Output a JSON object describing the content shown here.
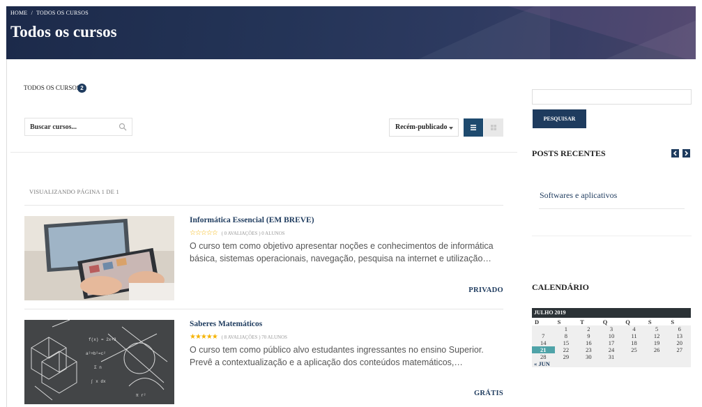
{
  "header": {
    "breadcrumb_home": "HOME",
    "breadcrumb_sep": "/",
    "breadcrumb_current": "TODOS OS CURSOS",
    "title": "Todos os cursos"
  },
  "main": {
    "count_label": "TODOS OS CURSOS",
    "count": "2",
    "search_placeholder": "Buscar cursos...",
    "sort_value": "Recém-publicado",
    "paging": "VISUALIZANDO PÁGINA 1 DE 1",
    "courses": [
      {
        "title": "Informática Essencial (EM BREVE)",
        "rating": 0,
        "reviews": "( 0 AVALIAÇÕES )",
        "students": "0 ALUNOS",
        "description": "O curso tem como objetivo apresentar noções e conhecimentos de informática básica, sistemas operacionais, navegação, pesquisa na internet e utilização…",
        "price": "PRIVADO"
      },
      {
        "title": "Saberes Matemáticos",
        "rating": 5,
        "reviews": "( 8 AVALIAÇÕES )",
        "students": "70 ALUNOS",
        "description": "O curso tem como público alvo estudantes ingressantes no ensino Superior. Prevê a contextualização e a aplicação dos conteúdos matemáticos,…",
        "price": "GRÁTIS"
      }
    ]
  },
  "sidebar": {
    "search_button": "PESQUISAR",
    "recent_heading": "POSTS RECENTES",
    "recent_posts": [
      "Softwares e aplicativos"
    ],
    "calendar_heading": "CALENDÁRIO",
    "calendar": {
      "month": "JULHO 2019",
      "weekdays": [
        "D",
        "S",
        "T",
        "Q",
        "Q",
        "S",
        "S"
      ],
      "weeks": [
        [
          "",
          "1",
          "2",
          "3",
          "4",
          "5",
          "6"
        ],
        [
          "7",
          "8",
          "9",
          "10",
          "11",
          "12",
          "13"
        ],
        [
          "14",
          "15",
          "16",
          "17",
          "18",
          "19",
          "20"
        ],
        [
          "21",
          "22",
          "23",
          "24",
          "25",
          "26",
          "27"
        ],
        [
          "28",
          "29",
          "30",
          "31",
          "",
          "",
          ""
        ]
      ],
      "today": "21",
      "prev_link": "« JUN"
    }
  },
  "colors": {
    "primary": "#1e3b5e",
    "star": "#f5b301",
    "today": "#4fa3a8"
  }
}
